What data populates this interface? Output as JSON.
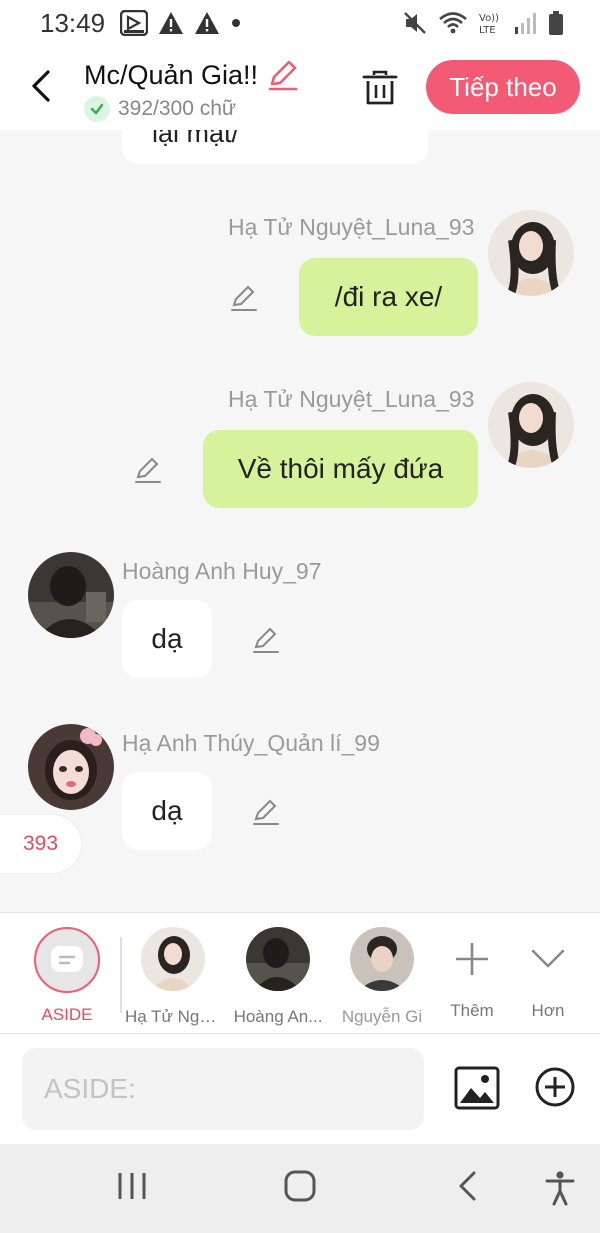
{
  "status_bar": {
    "time": "13:49",
    "left_icons": [
      "screen-record-icon",
      "warning-icon",
      "warning-icon",
      "dot-icon"
    ],
    "right_icons": [
      "mute-icon",
      "wifi-icon",
      "volte-icon",
      "signal-icon",
      "battery-icon"
    ]
  },
  "header": {
    "title": "Mc/Quản Gia!!",
    "word_count": "392/300 chữ",
    "next_label": "Tiếp theo"
  },
  "chat": {
    "partial_text": "lại mặt/",
    "messages": [
      {
        "sender": "Hạ Tử Nguyệt_Luna_93",
        "text": "/đi ra xe/",
        "side": "right"
      },
      {
        "sender": "Hạ Tử Nguyệt_Luna_93",
        "text": "Về thôi mấy đứa",
        "side": "right"
      },
      {
        "sender": "Hoàng Anh Huy_97",
        "text": "dạ",
        "side": "left"
      },
      {
        "sender": "Hạ Anh Thúy_Quản lí_99",
        "text": "dạ",
        "side": "left"
      }
    ],
    "counter": "393"
  },
  "characters": {
    "aside_label": "ASIDE",
    "items": [
      {
        "name": "Hạ Tử Ngu..."
      },
      {
        "name": "Hoàng An..."
      },
      {
        "name": "Nguyễn Gi"
      }
    ],
    "more_label": "Thêm",
    "expand_label": "Hơn"
  },
  "input": {
    "placeholder": "ASIDE:"
  },
  "colors": {
    "accent": "#f35a73",
    "bubble_green": "#d6f29b",
    "bubble_white": "#ffffff",
    "background": "#f6f6f6"
  }
}
